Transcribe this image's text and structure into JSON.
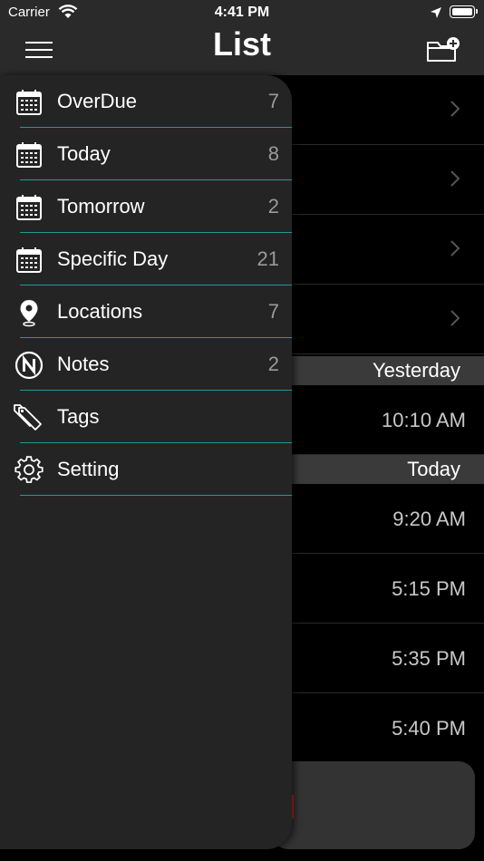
{
  "status_bar": {
    "carrier": "Carrier",
    "time": "4:41 PM"
  },
  "nav": {
    "title": "List",
    "menu_icon": "hamburger-menu-icon",
    "action_icon": "folder-add-icon"
  },
  "menu": {
    "items": [
      {
        "label": "OverDue",
        "count": "7",
        "icon": "calendar-icon"
      },
      {
        "label": "Today",
        "count": "8",
        "icon": "calendar-icon"
      },
      {
        "label": "Tomorrow",
        "count": "2",
        "icon": "calendar-icon"
      },
      {
        "label": "Specific Day",
        "count": "21",
        "icon": "calendar-icon"
      },
      {
        "label": "Locations",
        "count": "7",
        "icon": "location-pin-icon"
      },
      {
        "label": "Notes",
        "count": "2",
        "icon": "notes-n-icon"
      },
      {
        "label": "Tags",
        "count": "",
        "icon": "tags-icon"
      },
      {
        "label": "Setting",
        "count": "",
        "icon": "gear-icon"
      }
    ]
  },
  "background_list": {
    "sections": [
      {
        "label": "Yesterday",
        "times": [
          "10:10 AM"
        ]
      },
      {
        "label": "Today",
        "times": [
          "9:20 AM",
          "5:15 PM",
          "5:35 PM",
          "5:40 PM"
        ]
      }
    ]
  },
  "colors": {
    "bar_background": "#2a2a2a",
    "menu_background": "#242424",
    "divider_accent": "#1f9a97",
    "count_text": "#9a9a9a"
  }
}
